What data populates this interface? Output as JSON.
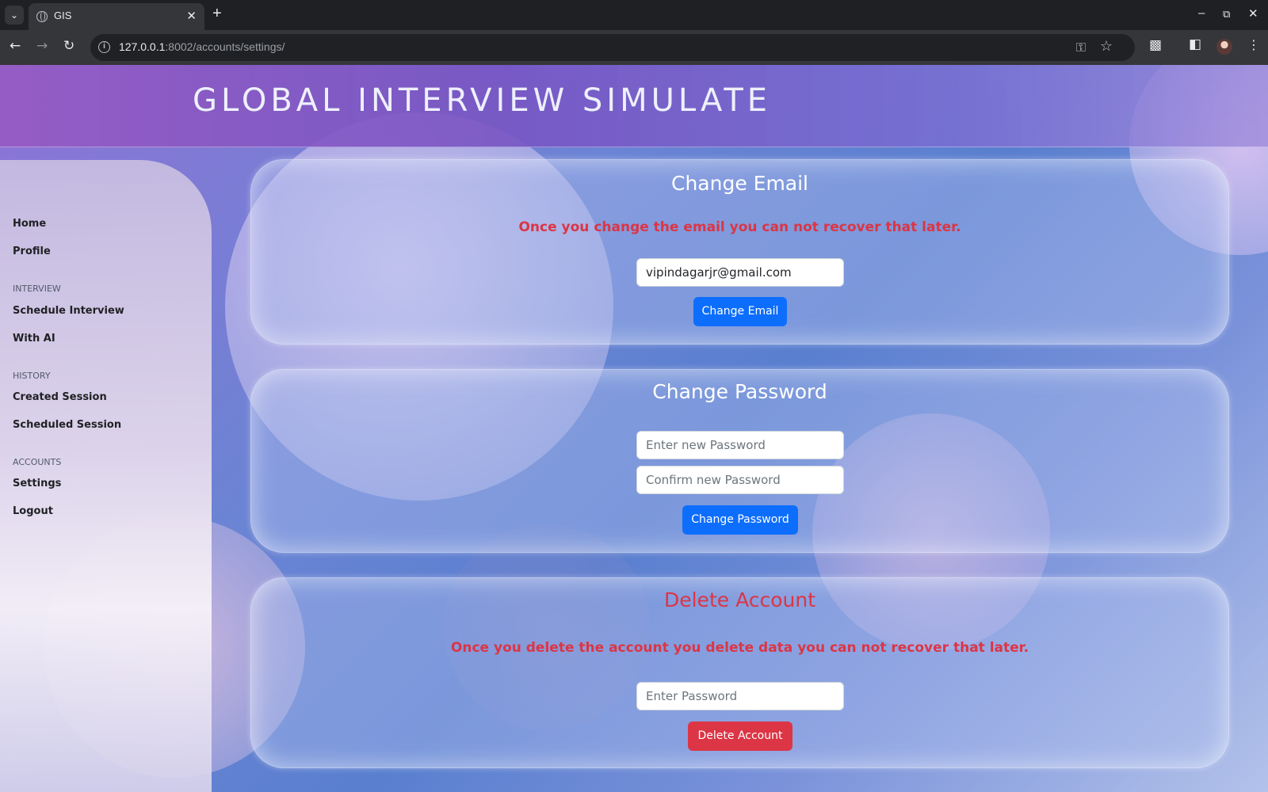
{
  "browser": {
    "tab_title": "GIS",
    "url_host": "127.0.0.1",
    "url_path": ":8002/accounts/settings/",
    "icons": [
      "tab-menu-icon",
      "globe-icon",
      "close-icon",
      "plus-icon",
      "back-icon",
      "forward-icon",
      "reload-icon",
      "info-icon",
      "key-icon",
      "star-icon",
      "extensions-icon",
      "side-panel-icon",
      "profile-avatar",
      "menu-icon",
      "minimize-icon",
      "restore-icon",
      "window-close-icon"
    ]
  },
  "header": {
    "title": "GLOBAL INTERVIEW SIMULATE"
  },
  "sidebar": {
    "home": "Home",
    "profile": "Profile",
    "interview_section": "INTERVIEW",
    "schedule_interview": "Schedule Interview",
    "with_ai": "With AI",
    "history_section": "HISTORY",
    "created_session": "Created Session",
    "scheduled_session": "Scheduled Session",
    "accounts_section": "ACCOUNTS",
    "settings": "Settings",
    "logout": "Logout"
  },
  "change_email": {
    "title": "Change Email",
    "warning": "Once you change the email you can not recover that later.",
    "email_value": "vipindagarjr@gmail.com",
    "button": "Change Email"
  },
  "change_password": {
    "title": "Change Password",
    "new_placeholder": "Enter new Password",
    "confirm_placeholder": "Confirm new Password",
    "button": "Change Password"
  },
  "delete_account": {
    "title": "Delete Account",
    "warning": "Once you delete the account you delete data you can not recover that later.",
    "password_placeholder": "Enter Password",
    "button": "Delete Account"
  },
  "colors": {
    "primary": "#0d6efd",
    "danger": "#dc3545"
  }
}
